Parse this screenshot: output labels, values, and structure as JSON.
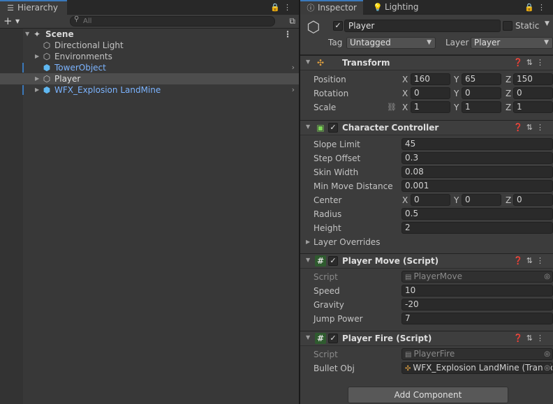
{
  "hierarchy": {
    "tab_label": "Hierarchy",
    "tab_icon": "list-icon",
    "search_placeholder": "All",
    "scene": "Scene",
    "items": [
      {
        "label": "Directional Light",
        "kind": "gameobject"
      },
      {
        "label": "Environments",
        "kind": "gameobject"
      },
      {
        "label": "TowerObject",
        "kind": "prefab"
      },
      {
        "label": "Player",
        "kind": "gameobject"
      },
      {
        "label": "WFX_Explosion LandMine",
        "kind": "prefab"
      }
    ]
  },
  "inspector": {
    "tabs": [
      {
        "label": "Inspector",
        "icon": "info-icon"
      },
      {
        "label": "Lighting",
        "icon": "lightbulb-icon"
      }
    ],
    "object_name": "Player",
    "static_label": "Static",
    "tag_label": "Tag",
    "tag_value": "Untagged",
    "layer_label": "Layer",
    "layer_value": "Player",
    "transform": {
      "title": "Transform",
      "position_label": "Position",
      "rotation_label": "Rotation",
      "scale_label": "Scale",
      "position": {
        "x": "160",
        "y": "65",
        "z": "150"
      },
      "rotation": {
        "x": "0",
        "y": "0",
        "z": "0"
      },
      "scale": {
        "x": "1",
        "y": "1",
        "z": "1"
      }
    },
    "character_controller": {
      "title": "Character Controller",
      "slope_limit_label": "Slope Limit",
      "slope_limit": "45",
      "step_offset_label": "Step Offset",
      "step_offset": "0.3",
      "skin_width_label": "Skin Width",
      "skin_width": "0.08",
      "min_move_label": "Min Move Distance",
      "min_move": "0.001",
      "center_label": "Center",
      "center": {
        "x": "0",
        "y": "0",
        "z": "0"
      },
      "radius_label": "Radius",
      "radius": "0.5",
      "height_label": "Height",
      "height": "2",
      "layer_overrides_label": "Layer Overrides"
    },
    "player_move": {
      "title": "Player Move (Script)",
      "script_label": "Script",
      "script": "PlayerMove",
      "speed_label": "Speed",
      "speed": "10",
      "gravity_label": "Gravity",
      "gravity": "-20",
      "jump_label": "Jump Power",
      "jump": "7"
    },
    "player_fire": {
      "title": "Player Fire (Script)",
      "script_label": "Script",
      "script": "PlayerFire",
      "bullet_label": "Bullet Obj",
      "bullet": "WFX_Explosion LandMine (Transform)"
    },
    "add_component_label": "Add Component"
  },
  "axes": {
    "x": "X",
    "y": "Y",
    "z": "Z"
  },
  "colors": {
    "accent": "#3a79bb",
    "prefab_text": "#7cb4ff",
    "selection": "#4d4d4d"
  }
}
